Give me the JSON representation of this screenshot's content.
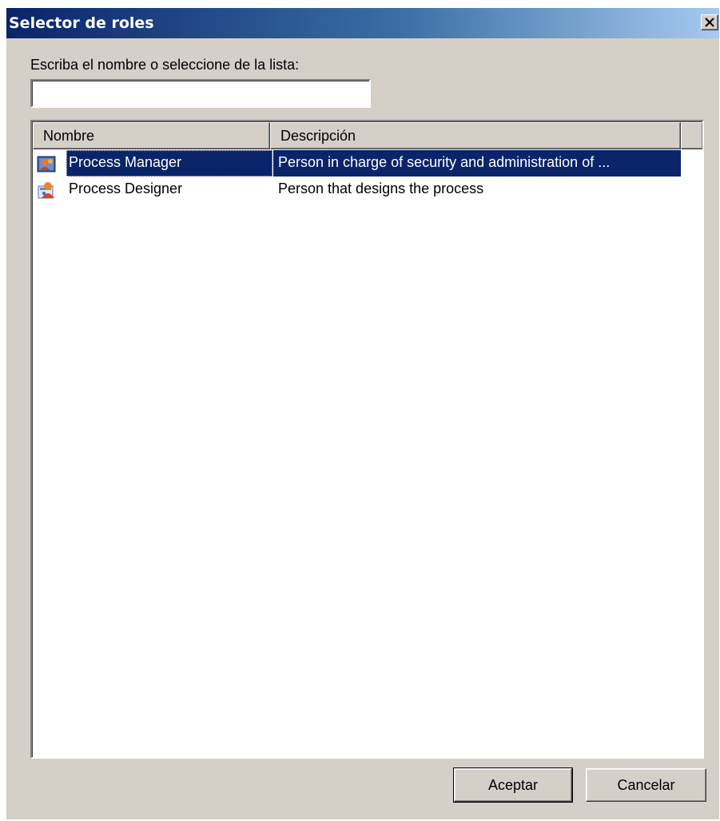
{
  "window": {
    "title": "Selector de roles",
    "close_icon": "close-x-icon",
    "title_gradient": [
      "#0a246a",
      "#a6caf0"
    ],
    "face_color": "#d4d0c8"
  },
  "search": {
    "label": "Escriba el nombre o seleccione de la lista:",
    "value": "",
    "placeholder": ""
  },
  "list": {
    "columns": [
      "Nombre",
      "Descripción"
    ],
    "selection_color": "#0a246a",
    "rows": [
      {
        "icon": "role-manager-icon",
        "name": "Process Manager",
        "description": "Person in charge of security and administration of ...",
        "selected": true
      },
      {
        "icon": "role-designer-icon",
        "name": "Process Designer",
        "description": "Person that designs the process",
        "selected": false
      }
    ]
  },
  "buttons": {
    "ok": "Aceptar",
    "cancel": "Cancelar"
  }
}
